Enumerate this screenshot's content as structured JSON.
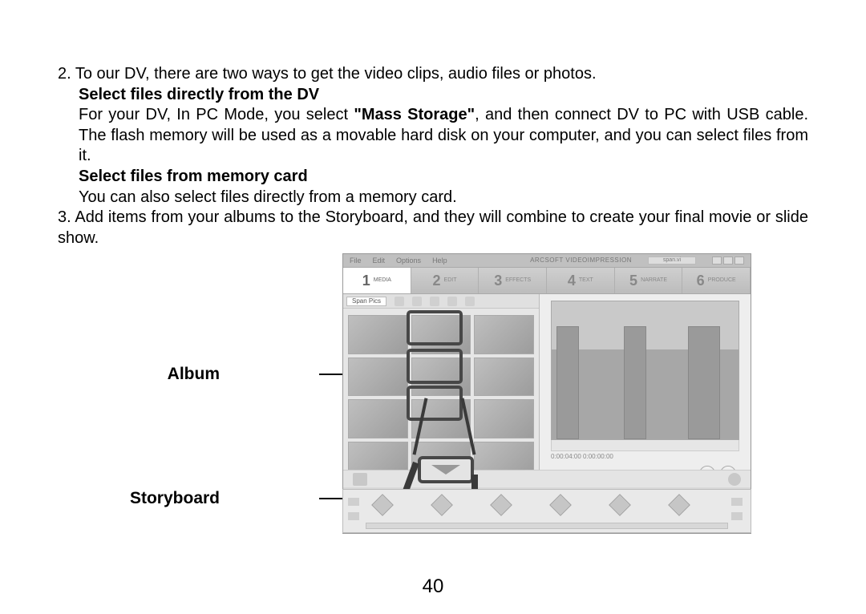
{
  "para1": "2. To our DV, there are two ways to get the video clips, audio files or photos.",
  "h1": "Select files directly from the DV",
  "para2a": "For your DV, In PC Mode, you select ",
  "para2b": "\"Mass Storage\"",
  "para2c": ", and then connect DV to PC with USB cable. The flash memory will be used as a movable hard disk on your computer, and you can select files from it.",
  "h2": "Select files from memory card",
  "para3": "You can also select files directly from a memory card.",
  "para4": "3. Add items from your albums to the Storyboard, and they will combine to create your final movie or slide show.",
  "page_number": "40",
  "annotation": {
    "album": "Album",
    "storyboard": "Storyboard"
  },
  "app": {
    "menu": {
      "file": "File",
      "edit": "Edit",
      "options": "Options",
      "help": "Help"
    },
    "title": "ARCSOFT VIDEOIMPRESSION",
    "document": "span.vi",
    "tabs": [
      {
        "num": "1",
        "label": "MEDIA"
      },
      {
        "num": "2",
        "label": "EDIT"
      },
      {
        "num": "3",
        "label": "EFFECTS"
      },
      {
        "num": "4",
        "label": "TEXT"
      },
      {
        "num": "5",
        "label": "NARRATE"
      },
      {
        "num": "6",
        "label": "PRODUCE"
      }
    ],
    "album_name": "Span Pics",
    "timecode": "0:00:04:00  0:00:00:00"
  }
}
